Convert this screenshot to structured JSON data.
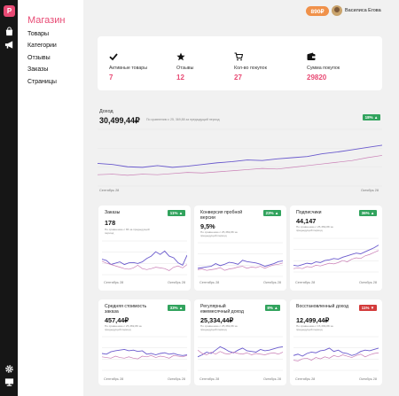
{
  "app": {
    "logo_letter": "P",
    "brand": "Магазин",
    "nav": [
      "Товары",
      "Категории",
      "Отзывы",
      "Заказы",
      "Страницы"
    ]
  },
  "header": {
    "price": "890₽",
    "username": "Василиса Егова"
  },
  "stats": [
    {
      "icon": "checkmark-icon",
      "label": "Активные товары",
      "value": "7"
    },
    {
      "icon": "star-icon",
      "label": "Отзывы",
      "value": "12"
    },
    {
      "icon": "cart-icon",
      "label": "Кол-во покупок",
      "value": "27"
    },
    {
      "icon": "wallet-icon",
      "label": "Сумма покупок",
      "value": "29820"
    }
  ],
  "colors": {
    "accent": "#e84a74",
    "primary_line": "#6a5acd",
    "secondary_line": "#c97eb5",
    "badge_up": "#31a35d",
    "badge_down": "#d33b3b",
    "pill": "#f0914a"
  },
  "revenue": {
    "label": "Доход",
    "value": "30,499,44₽",
    "comparison": "По сравнению с 25, 369,88 за предыдущий период",
    "badge": "18% ▲",
    "x_start": "Сентябрь 28",
    "x_end": "Октябрь 28"
  },
  "cards": [
    {
      "title": "Заказы",
      "value": "178",
      "comparison": "По сравнению с 86 за предыдущий период",
      "badge": "11% ▲",
      "trend": "up",
      "x_start": "Сентябрь 28",
      "x_end": "Октябрь 28"
    },
    {
      "title": "Конверсия пробной версии",
      "value": "9,5%",
      "comparison": "По сравнению с 25,369,88 за предыдущий период",
      "badge": "23% ▲",
      "trend": "up",
      "x_start": "Сентябрь 28",
      "x_end": "Октябрь 28"
    },
    {
      "title": "Подписчики",
      "value": "44,147",
      "comparison": "По сравнению с 25,369,88 за предыдущий период",
      "badge": "36% ▲",
      "trend": "up",
      "x_start": "Сентябрь 28",
      "x_end": "Октябрь 28"
    },
    {
      "title": "Средняя стоимость заказа",
      "value": "457,44₽",
      "comparison": "По сравнению с 25,369,88 за предыдущий период",
      "badge": "33% ▲",
      "trend": "up",
      "x_start": "Сентябрь 28",
      "x_end": "Октябрь 28"
    },
    {
      "title": "Регулярный ежемесячный доход",
      "value": "25,334,44₽",
      "comparison": "По сравнению с 25,369,88 за предыдущий период",
      "badge": "8% ▲",
      "trend": "up",
      "x_start": "Сентябрь 28",
      "x_end": "Октябрь 28"
    },
    {
      "title": "Восстановленный доход",
      "value": "12,499,44₽",
      "comparison": "По сравнению с 15,309,88 за предыдущий период",
      "badge": "11% ▼",
      "trend": "down",
      "x_start": "Сентябрь 28",
      "x_end": "Октябрь 28"
    }
  ],
  "chart_data": [
    {
      "type": "line",
      "title": "Доход",
      "series": [
        {
          "values": [
            40,
            38,
            34,
            33,
            36,
            33,
            35,
            38,
            41,
            43,
            46,
            45,
            48,
            50,
            52,
            57,
            60,
            64,
            68,
            72
          ]
        },
        {
          "values": [
            20,
            21,
            19,
            21,
            20,
            22,
            24,
            23,
            25,
            27,
            29,
            31,
            30,
            33,
            36,
            39,
            42,
            45,
            50,
            54
          ]
        }
      ]
    },
    {
      "type": "line",
      "title": "Заказы",
      "series": [
        {
          "values": [
            46,
            42,
            30,
            34,
            38,
            30,
            35,
            36,
            33,
            38,
            48,
            55,
            68,
            60,
            70,
            55,
            50,
            35,
            28,
            58
          ]
        },
        {
          "values": [
            40,
            34,
            30,
            26,
            22,
            18,
            16,
            20,
            28,
            18,
            15,
            18,
            22,
            20,
            18,
            12,
            22,
            26,
            20,
            30
          ]
        }
      ]
    },
    {
      "type": "line",
      "title": "Конверсия пробной версии",
      "series": [
        {
          "values": [
            24,
            26,
            28,
            30,
            38,
            32,
            36,
            42,
            40,
            36,
            48,
            44,
            42,
            40,
            36,
            30,
            34,
            38,
            44,
            46
          ]
        },
        {
          "values": [
            20,
            22,
            18,
            20,
            22,
            26,
            18,
            22,
            24,
            28,
            30,
            24,
            28,
            26,
            30,
            24,
            30,
            34,
            36,
            40
          ]
        }
      ]
    },
    {
      "type": "line",
      "title": "Подписчики",
      "series": [
        {
          "values": [
            20,
            18,
            22,
            26,
            24,
            30,
            28,
            34,
            36,
            40,
            38,
            44,
            48,
            52,
            56,
            54,
            60,
            66,
            72,
            80
          ]
        },
        {
          "values": [
            10,
            12,
            10,
            16,
            14,
            20,
            18,
            22,
            26,
            24,
            28,
            34,
            30,
            38,
            42,
            40,
            48,
            52,
            58,
            64
          ]
        }
      ]
    },
    {
      "type": "line",
      "title": "Средняя стоимость заказа",
      "series": [
        {
          "values": [
            50,
            48,
            55,
            58,
            60,
            62,
            58,
            60,
            56,
            58,
            48,
            50,
            46,
            50,
            52,
            48,
            50,
            46,
            44,
            46
          ]
        },
        {
          "values": [
            40,
            38,
            36,
            42,
            38,
            36,
            40,
            36,
            34,
            42,
            40,
            44,
            38,
            42,
            40,
            36,
            44,
            42,
            40,
            44
          ]
        }
      ]
    },
    {
      "type": "line",
      "title": "Регулярный ежемесячный доход",
      "series": [
        {
          "values": [
            40,
            46,
            54,
            50,
            60,
            70,
            64,
            56,
            52,
            60,
            66,
            58,
            56,
            54,
            62,
            58,
            60,
            64,
            68,
            70
          ]
        },
        {
          "values": [
            60,
            50,
            46,
            54,
            48,
            56,
            50,
            48,
            54,
            50,
            48,
            52,
            46,
            50,
            48,
            46,
            50,
            52,
            48,
            54
          ]
        }
      ]
    },
    {
      "type": "line",
      "title": "Восстановленный доход",
      "series": [
        {
          "values": [
            44,
            48,
            42,
            50,
            54,
            52,
            58,
            60,
            66,
            56,
            60,
            52,
            50,
            44,
            48,
            56,
            60,
            58,
            62,
            66
          ]
        },
        {
          "values": [
            30,
            28,
            34,
            36,
            30,
            38,
            34,
            40,
            36,
            44,
            40,
            46,
            42,
            38,
            44,
            48,
            40,
            46,
            50,
            52
          ]
        }
      ]
    }
  ]
}
